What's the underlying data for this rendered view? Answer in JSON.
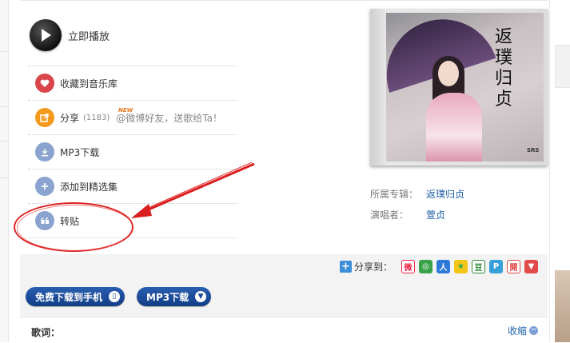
{
  "player": {
    "play_label": "立即播放"
  },
  "actions": [
    {
      "label": "收藏到音乐库",
      "icon": "heart-icon"
    },
    {
      "label": "分享",
      "count": "(1183)",
      "badge": "NEW",
      "hint": "@微博好友，送歌给Ta！",
      "icon": "share-icon"
    },
    {
      "label": "MP3下载",
      "icon": "download-icon"
    },
    {
      "label": "添加到精选集",
      "icon": "plus-icon"
    },
    {
      "label": "转贴",
      "icon": "quote-icon"
    }
  ],
  "album": {
    "cover_title": "返璞归贞",
    "cover_logo": "SRS",
    "album_key": "所属专辑：",
    "album_value": "返璞归贞",
    "artist_key": "演唱者：",
    "artist_value": "萱贞"
  },
  "share_to": {
    "label": "分享到："
  },
  "buttons": {
    "mobile_download": "免费下载到手机",
    "mp3_download": "MP3下载"
  },
  "lyrics": {
    "label": "歌词：",
    "collapse": "收缩"
  },
  "colors": {
    "link": "#1e5fa8",
    "button": "#1b4a98",
    "annotation": "#dd2222"
  }
}
